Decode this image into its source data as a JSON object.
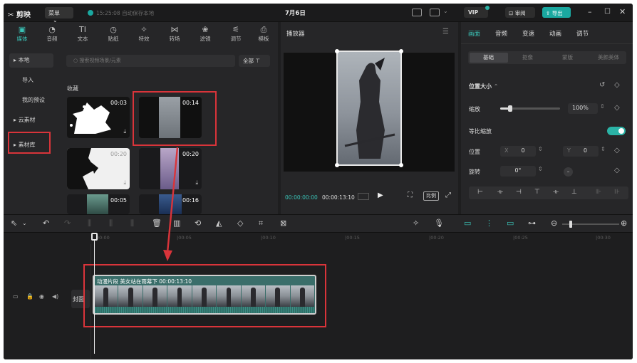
{
  "titlebar": {
    "logo": "剪映",
    "menu_label": "菜单",
    "autosave": "15:25:08 自动保存本地",
    "doc_title": "7月6日",
    "vip_label": "VIP",
    "review_label": "审阅",
    "export_label": "导出"
  },
  "media_tabs": [
    {
      "label": "媒体",
      "icon": "media-icon",
      "glyph": "▣"
    },
    {
      "label": "音频",
      "icon": "audio-icon",
      "glyph": "◔"
    },
    {
      "label": "文本",
      "icon": "text-icon",
      "glyph": "TI"
    },
    {
      "label": "贴纸",
      "icon": "sticker-icon",
      "glyph": "◷"
    },
    {
      "label": "特效",
      "icon": "effects-icon",
      "glyph": "✧"
    },
    {
      "label": "转场",
      "icon": "transition-icon",
      "glyph": "⋈"
    },
    {
      "label": "滤镜",
      "icon": "filter-icon",
      "glyph": "❀"
    },
    {
      "label": "调节",
      "icon": "adjust-icon",
      "glyph": "⚟"
    },
    {
      "label": "模板",
      "icon": "template-icon",
      "glyph": "⎙"
    }
  ],
  "sidebar": {
    "items": [
      "本地",
      "导入",
      "我的预设",
      "云素材",
      "素材库"
    ]
  },
  "library": {
    "search_placeholder": "搜索视频场景/元素",
    "filter_label": "全部",
    "section_label": "收藏",
    "items": [
      {
        "duration": "00:03"
      },
      {
        "duration": "00:14"
      },
      {
        "duration": "00:20"
      },
      {
        "duration": "00:20"
      },
      {
        "duration": "00:05"
      },
      {
        "duration": "00:16"
      }
    ]
  },
  "player": {
    "title": "播放器",
    "current_time": "00:00:00:00",
    "total_time": "00:00:13:10",
    "ratio_label": "比例"
  },
  "props": {
    "tabs": [
      "画面",
      "音频",
      "变速",
      "动画",
      "调节"
    ],
    "subtabs": [
      "基础",
      "抠像",
      "蒙版",
      "美颜美体"
    ],
    "section": "位置大小",
    "scale_label": "缩放",
    "scale_value": "100%",
    "scale_level": 0.17,
    "uniform_label": "等比缩放",
    "position_label": "位置",
    "pos_x_label": "X",
    "pos_x": "0",
    "pos_y_label": "Y",
    "pos_y": "0",
    "rotate_label": "旋转",
    "rotate_value": "0°"
  },
  "timeline": {
    "ruler": [
      "00:00",
      "|00:05",
      "|00:10",
      "|00:15",
      "|00:20",
      "|00:25",
      "|00:30"
    ],
    "cover_label": "封面",
    "clip_title": "动漫片段 美女站在雨幕下  00:00:13:10"
  }
}
